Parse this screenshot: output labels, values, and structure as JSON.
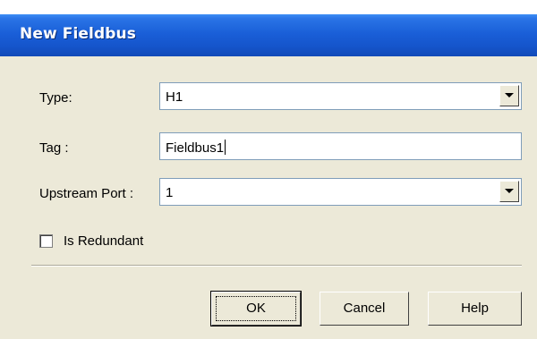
{
  "dialog": {
    "title": "New Fieldbus"
  },
  "form": {
    "type_label": "Type:",
    "type_value": "H1",
    "tag_label": "Tag :",
    "tag_value": "Fieldbus1",
    "upstream_label": "Upstream Port :",
    "upstream_value": "1",
    "redundant_label": "Is Redundant",
    "redundant_checked": false
  },
  "buttons": {
    "ok": "OK",
    "cancel": "Cancel",
    "help": "Help"
  },
  "icons": [
    "chevron-down-icon"
  ]
}
